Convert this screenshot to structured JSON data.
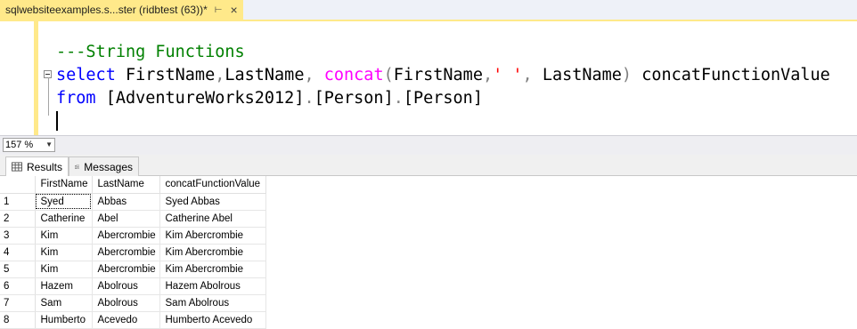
{
  "tab": {
    "title": "sqlwebsiteexamples.s...ster (ridbtest (63))*",
    "pin_icon": "pin-icon",
    "close_icon": "close-icon"
  },
  "editor": {
    "lines": [
      {
        "segments": [
          {
            "t": "---String Functions",
            "c": "cm"
          }
        ]
      },
      {
        "segments": [
          {
            "t": "select",
            "c": "kw"
          },
          {
            "t": " FirstName",
            "c": "tx"
          },
          {
            "t": ",",
            "c": "gr"
          },
          {
            "t": "LastName",
            "c": "tx"
          },
          {
            "t": ", ",
            "c": "gr"
          },
          {
            "t": "concat",
            "c": "fn"
          },
          {
            "t": "(",
            "c": "gr"
          },
          {
            "t": "FirstName",
            "c": "tx"
          },
          {
            "t": ",",
            "c": "gr"
          },
          {
            "t": "' '",
            "c": "str"
          },
          {
            "t": ", ",
            "c": "gr"
          },
          {
            "t": "LastName",
            "c": "tx"
          },
          {
            "t": ")",
            "c": "gr"
          },
          {
            "t": " concatFunctionValue",
            "c": "tx"
          }
        ]
      },
      {
        "segments": [
          {
            "t": "from",
            "c": "kw"
          },
          {
            "t": " [AdventureWorks2012]",
            "c": "tx"
          },
          {
            "t": ".",
            "c": "gr"
          },
          {
            "t": "[Person]",
            "c": "tx"
          },
          {
            "t": ".",
            "c": "gr"
          },
          {
            "t": "[Person]",
            "c": "tx"
          }
        ]
      }
    ]
  },
  "zoom": {
    "value": "157 %"
  },
  "result_tabs": [
    {
      "label": "Results",
      "icon": "grid-icon",
      "active": true
    },
    {
      "label": "Messages",
      "icon": "messages-icon",
      "active": false
    }
  ],
  "grid": {
    "columns": [
      "",
      "FirstName",
      "LastName",
      "concatFunctionValue"
    ],
    "rows": [
      [
        "1",
        "Syed",
        "Abbas",
        "Syed Abbas"
      ],
      [
        "2",
        "Catherine",
        "Abel",
        "Catherine Abel"
      ],
      [
        "3",
        "Kim",
        "Abercrombie",
        "Kim Abercrombie"
      ],
      [
        "4",
        "Kim",
        "Abercrombie",
        "Kim Abercrombie"
      ],
      [
        "5",
        "Kim",
        "Abercrombie",
        "Kim Abercrombie"
      ],
      [
        "6",
        "Hazem",
        "Abolrous",
        "Hazem Abolrous"
      ],
      [
        "7",
        "Sam",
        "Abolrous",
        "Sam Abolrous"
      ],
      [
        "8",
        "Humberto",
        "Acevedo",
        "Humberto Acevedo"
      ]
    ]
  },
  "colors": {
    "tab_active": "#ffe98a",
    "keyword": "#0000ff",
    "comment": "#008000",
    "function": "#ff00ff",
    "string": "#ff0000",
    "operator": "#808080"
  }
}
